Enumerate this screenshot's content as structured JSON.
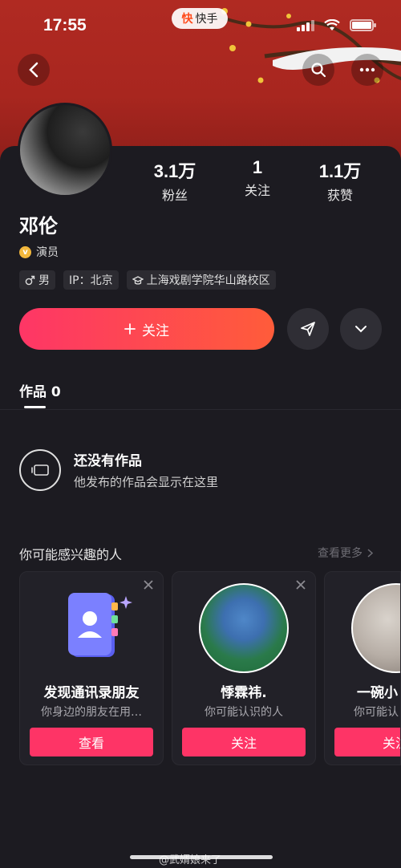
{
  "statusbar": {
    "time": "17:55",
    "app_logo": "快",
    "app_name": "快手"
  },
  "profile": {
    "name": "邓伦",
    "verify_badge": "v",
    "verify_label": "演员",
    "tags": {
      "gender": "男",
      "ip": "IP：北京",
      "school": "上海戏剧学院华山路校区"
    },
    "stats": [
      {
        "value": "3.1万",
        "label": "粉丝"
      },
      {
        "value": "1",
        "label": "关注"
      },
      {
        "value": "1.1万",
        "label": "获赞"
      }
    ],
    "follow_label": "关注"
  },
  "tabs": {
    "works": "作品 0"
  },
  "empty": {
    "title": "还没有作品",
    "subtitle": "他发布的作品会显示在这里"
  },
  "recommend": {
    "title": "你可能感兴趣的人",
    "more": "查看更多",
    "cards": [
      {
        "name": "发现通讯录朋友",
        "sub": "你身边的朋友在用…",
        "button": "查看"
      },
      {
        "name": "悸霖祎.",
        "sub": "你可能认识的人",
        "button": "关注"
      },
      {
        "name": "一碗小",
        "sub": "你可能认",
        "button": "关注"
      }
    ]
  },
  "watermark": "@武婿娘来了",
  "colors": {
    "accent": "#fe3466",
    "banner": "#b02a22",
    "background": "#1c1b21"
  },
  "icons": [
    "back-icon",
    "search-icon",
    "more-icon",
    "share-icon",
    "chevron-down-icon",
    "plus-icon",
    "male-icon",
    "school-icon",
    "video-icon",
    "close-icon"
  ]
}
